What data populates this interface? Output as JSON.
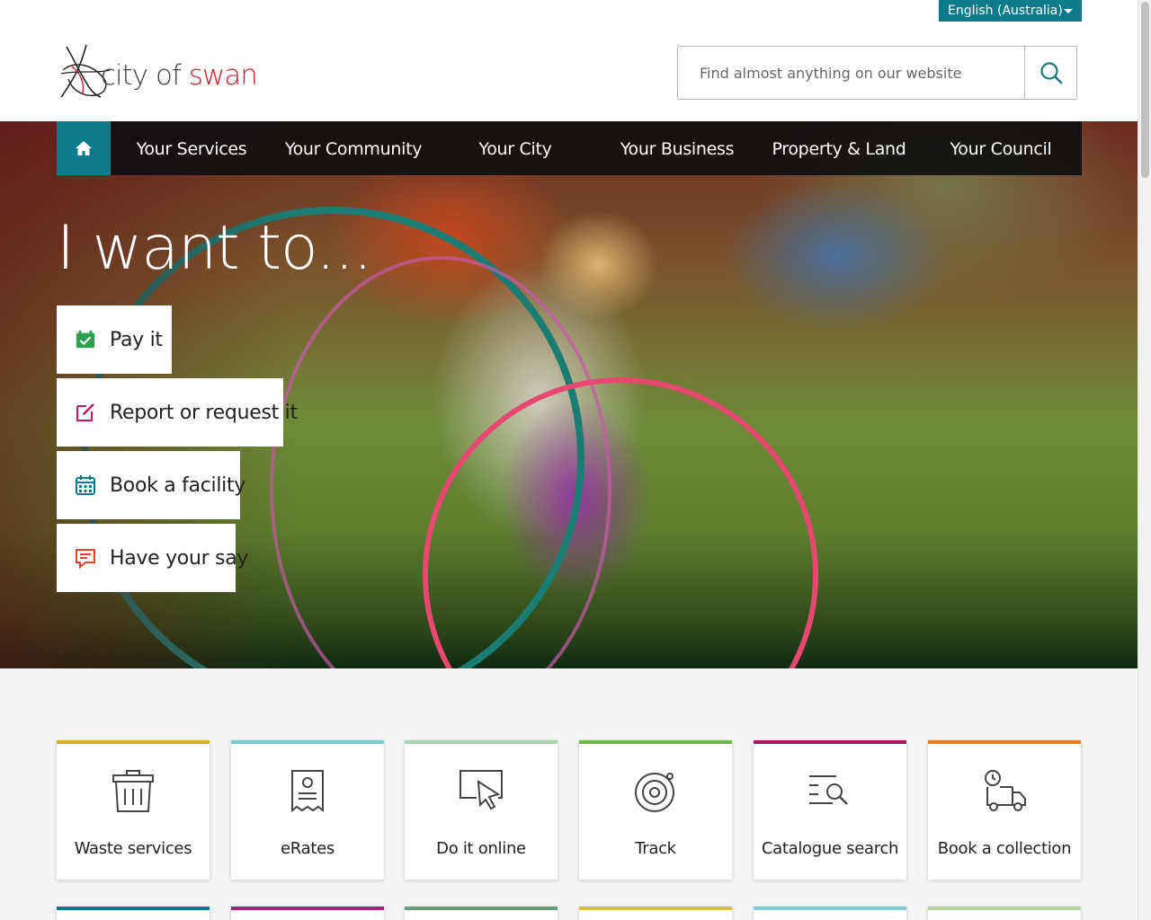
{
  "header": {
    "language": "English (Australia)",
    "logo": {
      "city": "city of",
      "swan": "swan"
    },
    "search": {
      "placeholder": "Find almost anything on our website"
    }
  },
  "nav": {
    "home_icon": "home-icon",
    "items": [
      {
        "label": "Your Services"
      },
      {
        "label": "Your Community"
      },
      {
        "label": "Your City"
      },
      {
        "label": "Your Business"
      },
      {
        "label": "Property & Land"
      },
      {
        "label": "Your Council"
      }
    ]
  },
  "hero": {
    "title": "I want to...",
    "actions": [
      {
        "label": "Pay it",
        "icon": "payment-icon",
        "color": "#2e9e4f"
      },
      {
        "label": "Report or request it",
        "icon": "edit-icon",
        "color": "#c2185b"
      },
      {
        "label": "Book a facility",
        "icon": "calendar-icon",
        "color": "#0b7b8b"
      },
      {
        "label": "Have your say",
        "icon": "comment-icon",
        "color": "#d9442a"
      }
    ]
  },
  "tiles": [
    {
      "label": "Waste services",
      "icon": "bin-icon",
      "color": "#d4b21f"
    },
    {
      "label": "eRates",
      "icon": "receipt-icon",
      "color": "#7cc9cf"
    },
    {
      "label": "Do it online",
      "icon": "cursor-icon",
      "color": "#a9d4b3"
    },
    {
      "label": "Track",
      "icon": "target-icon",
      "color": "#6fb84a"
    },
    {
      "label": "Catalogue search",
      "icon": "list-search-icon",
      "color": "#b0125e"
    },
    {
      "label": "Book a collection",
      "icon": "truck-icon",
      "color": "#e57c25"
    }
  ],
  "tiles_row2_colors": [
    "#0b7b8b",
    "#a3237a",
    "#6a9a7a",
    "#d4c23a",
    "#7cc9cf",
    "#b7d4a7"
  ]
}
